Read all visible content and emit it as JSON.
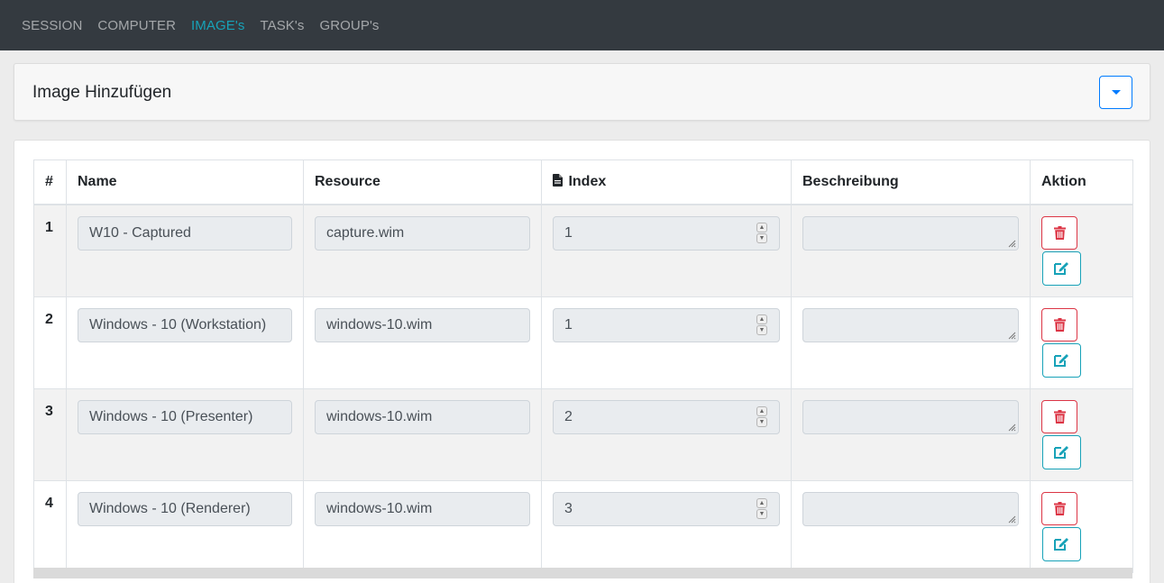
{
  "nav": {
    "items": [
      {
        "label": "SESSION",
        "active": false
      },
      {
        "label": "COMPUTER",
        "active": false
      },
      {
        "label": "IMAGE's",
        "active": true
      },
      {
        "label": "TASK's",
        "active": false
      },
      {
        "label": "GROUP's",
        "active": false
      }
    ]
  },
  "add_card": {
    "title": "Image Hinzufügen",
    "toggle_icon": "caret-down-icon"
  },
  "table": {
    "headers": {
      "num": "#",
      "name": "Name",
      "resource": "Resource",
      "index": "Index",
      "index_icon": "file-icon",
      "description": "Beschreibung",
      "action": "Aktion"
    },
    "rows": [
      {
        "num": "1",
        "name": "W10 - Captured",
        "resource": "capture.wim",
        "index": "1",
        "description": ""
      },
      {
        "num": "2",
        "name": "Windows - 10 (Workstation)",
        "resource": "windows-10.wim",
        "index": "1",
        "description": ""
      },
      {
        "num": "3",
        "name": "Windows - 10 (Presenter)",
        "resource": "windows-10.wim",
        "index": "2",
        "description": ""
      },
      {
        "num": "4",
        "name": "Windows - 10 (Renderer)",
        "resource": "windows-10.wim",
        "index": "3",
        "description": ""
      }
    ]
  },
  "colors": {
    "navbar": "#343a40",
    "nav_active": "#17a2b8",
    "primary": "#007bff",
    "danger": "#dc3545",
    "info": "#17a2b8"
  }
}
